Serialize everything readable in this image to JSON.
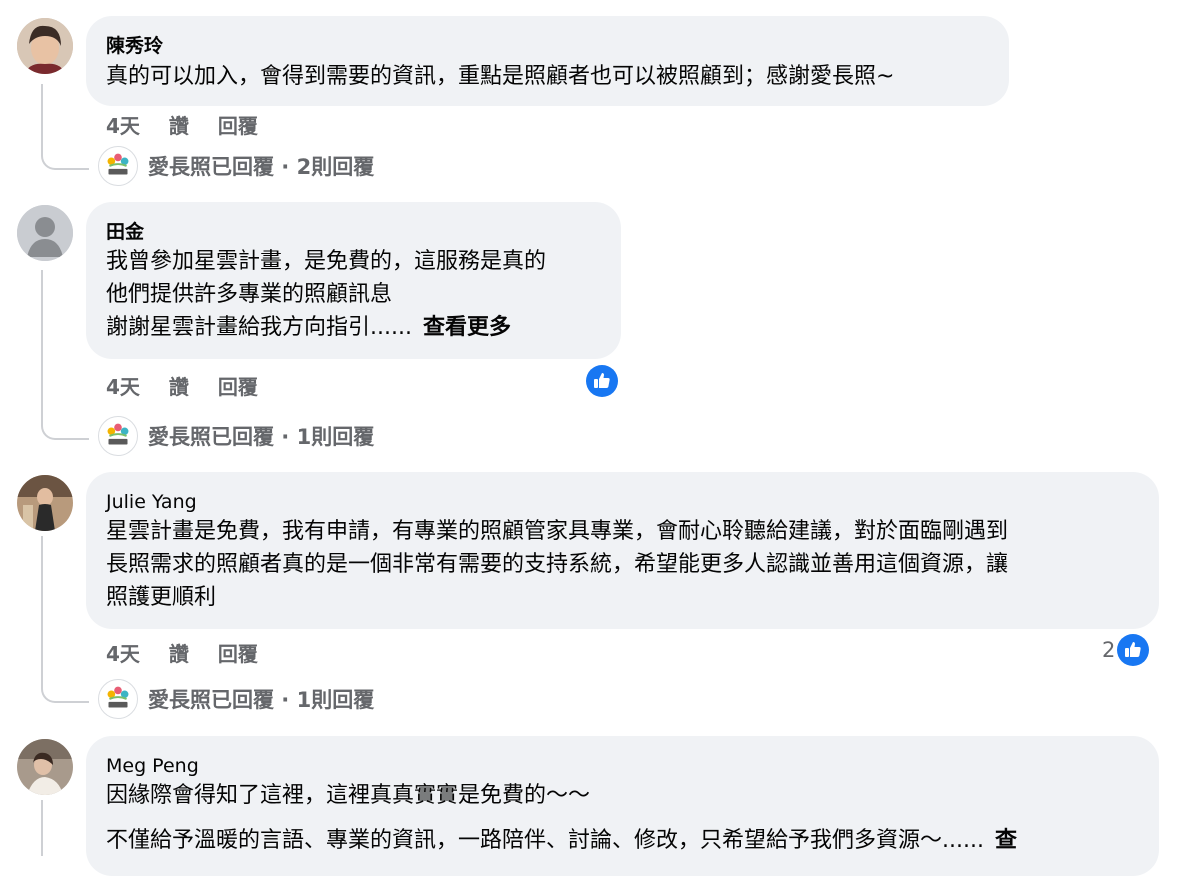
{
  "colors": {
    "bubble": "#f0f2f5",
    "meta": "#65676b",
    "like_blue": "#1877f2",
    "thread": "#ced0d4"
  },
  "comments": [
    {
      "author": "陳秀玲",
      "lines": [
        "真的可以加入，會得到需要的資訊，重點是照顧者也可以被照顧到；感謝愛長照~"
      ],
      "time": "4天",
      "like_label": "讚",
      "reply_label": "回覆",
      "page_reply": "愛長照已回覆 · 2則回覆"
    },
    {
      "author": "田金",
      "lines": [
        "我曾參加星雲計畫，是免費的，這服務是真的",
        "他們提供許多專業的照顧訊息",
        "謝謝星雲計畫給我方向指引......"
      ],
      "see_more": "查看更多",
      "time": "4天",
      "like_label": "讚",
      "reply_label": "回覆",
      "reaction_icon": "like-icon",
      "page_reply": "愛長照已回覆 · 1則回覆"
    },
    {
      "author": "Julie Yang",
      "lines": [
        "星雲計畫是免費，我有申請，有專業的照顧管家具專業，會耐心聆聽給建議，對於面臨剛遇到",
        "長照需求的照顧者真的是一個非常有需要的支持系統，希望能更多人認識並善用這個資源，讓",
        "照護更順利"
      ],
      "time": "4天",
      "like_label": "讚",
      "reply_label": "回覆",
      "reaction_count": "2",
      "reaction_icon": "like-icon",
      "page_reply": "愛長照已回覆 · 1則回覆"
    },
    {
      "author": "Meg Peng",
      "lines": [
        "因緣際會得知了這裡，這裡真真實實是免費的～～",
        "不僅給予溫暖的言語、專業的資訊，一路陪伴、討論、修改，只希望給予我們多資源～......"
      ],
      "see_more": "查"
    }
  ]
}
